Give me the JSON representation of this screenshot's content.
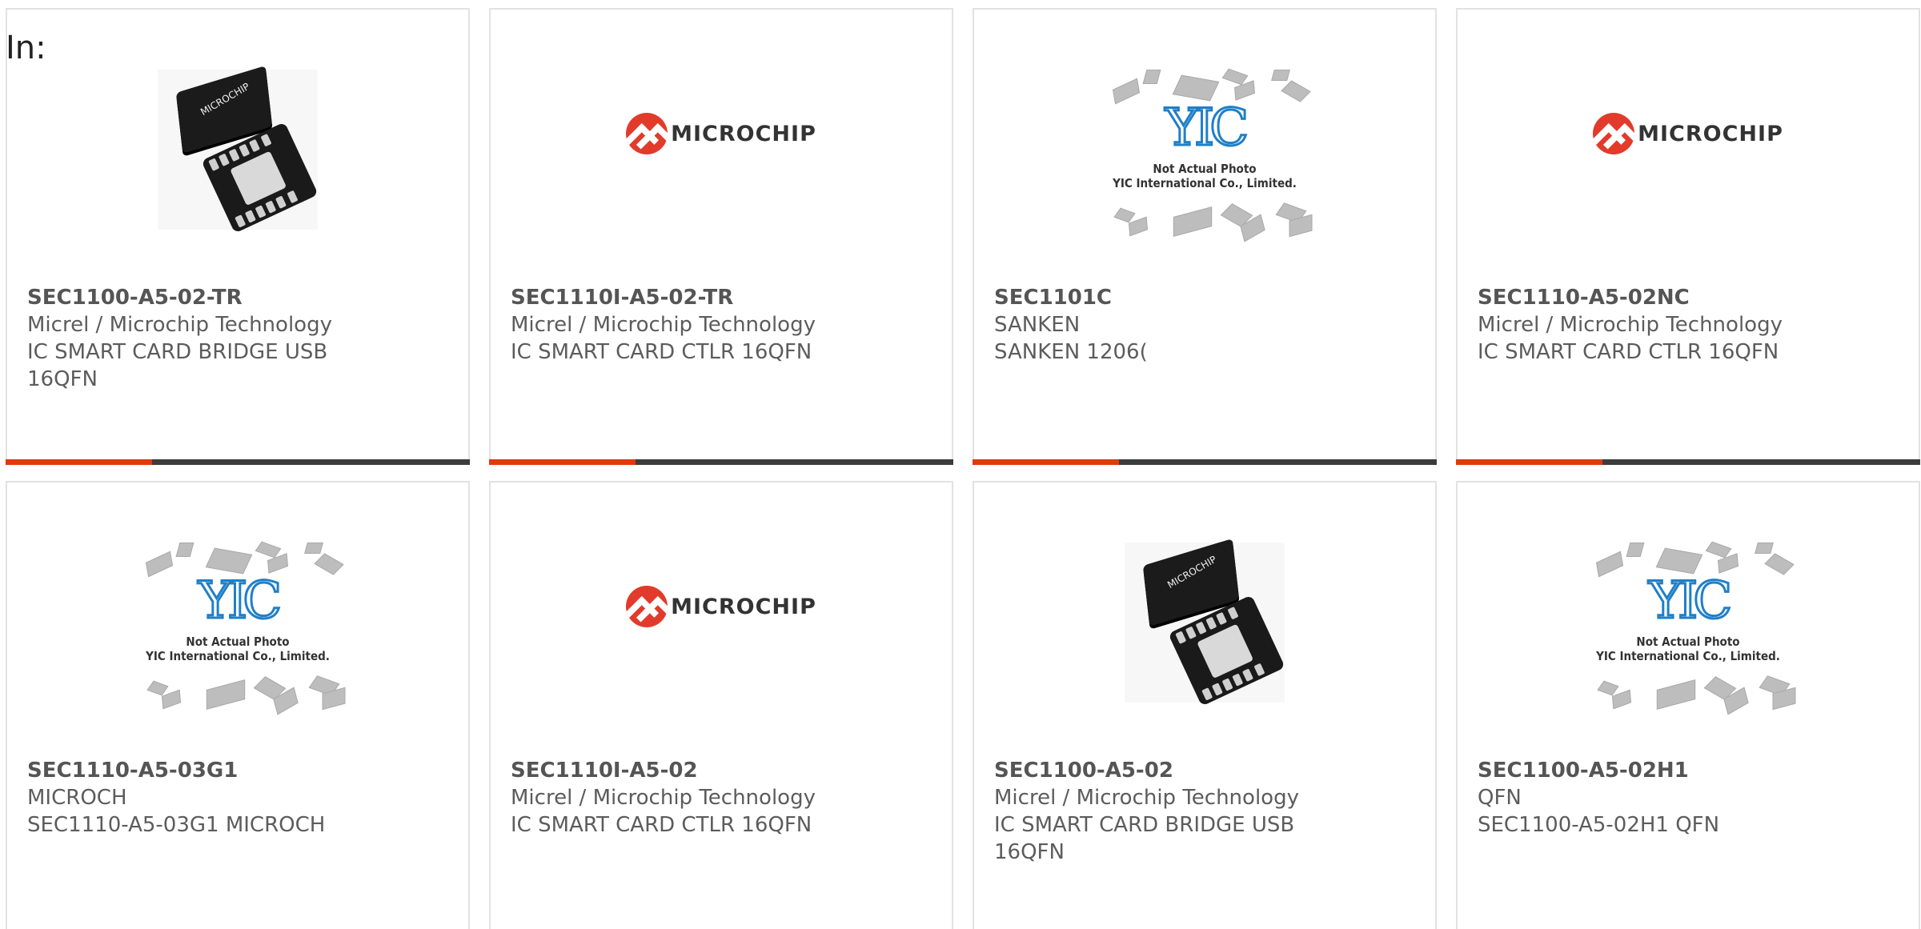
{
  "header": {
    "in_label": "In:"
  },
  "colors": {
    "accent": "#e03a0d",
    "bar_dark": "#3c3c3c",
    "text": "#5c5c5c"
  },
  "logos": {
    "microchip": "MICROCHIP",
    "chip_marking": "MICROCHIP",
    "yic_mark": "YIC",
    "yic_caption_1": "Not Actual Photo",
    "yic_caption_2": "YIC International Co., Limited."
  },
  "products": [
    {
      "part": "SEC1100-A5-02-TR",
      "maker": "Micrel / Microchip Technology",
      "desc_1": "IC SMART CARD BRIDGE USB",
      "desc_2": "16QFN",
      "image": "chip-photo"
    },
    {
      "part": "SEC1110I-A5-02-TR",
      "maker": "Micrel / Microchip Technology",
      "desc_1": "IC SMART CARD CTLR 16QFN",
      "desc_2": "",
      "image": "microchip-logo"
    },
    {
      "part": "SEC1101C",
      "maker": "SANKEN",
      "desc_1": "SANKEN 1206(",
      "desc_2": "",
      "image": "yic-placeholder"
    },
    {
      "part": "SEC1110-A5-02NC",
      "maker": "Micrel / Microchip Technology",
      "desc_1": "IC SMART CARD CTLR 16QFN",
      "desc_2": "",
      "image": "microchip-logo"
    },
    {
      "part": "SEC1110-A5-03G1",
      "maker": "MICROCH",
      "desc_1": "SEC1110-A5-03G1 MICROCH",
      "desc_2": "",
      "image": "yic-placeholder"
    },
    {
      "part": "SEC1110I-A5-02",
      "maker": "Micrel / Microchip Technology",
      "desc_1": "IC SMART CARD CTLR 16QFN",
      "desc_2": "",
      "image": "microchip-logo"
    },
    {
      "part": "SEC1100-A5-02",
      "maker": "Micrel / Microchip Technology",
      "desc_1": "IC SMART CARD BRIDGE USB",
      "desc_2": "16QFN",
      "image": "chip-photo"
    },
    {
      "part": "SEC1100-A5-02H1",
      "maker": "QFN",
      "desc_1": "SEC1100-A5-02H1 QFN",
      "desc_2": "",
      "image": "yic-placeholder"
    }
  ]
}
